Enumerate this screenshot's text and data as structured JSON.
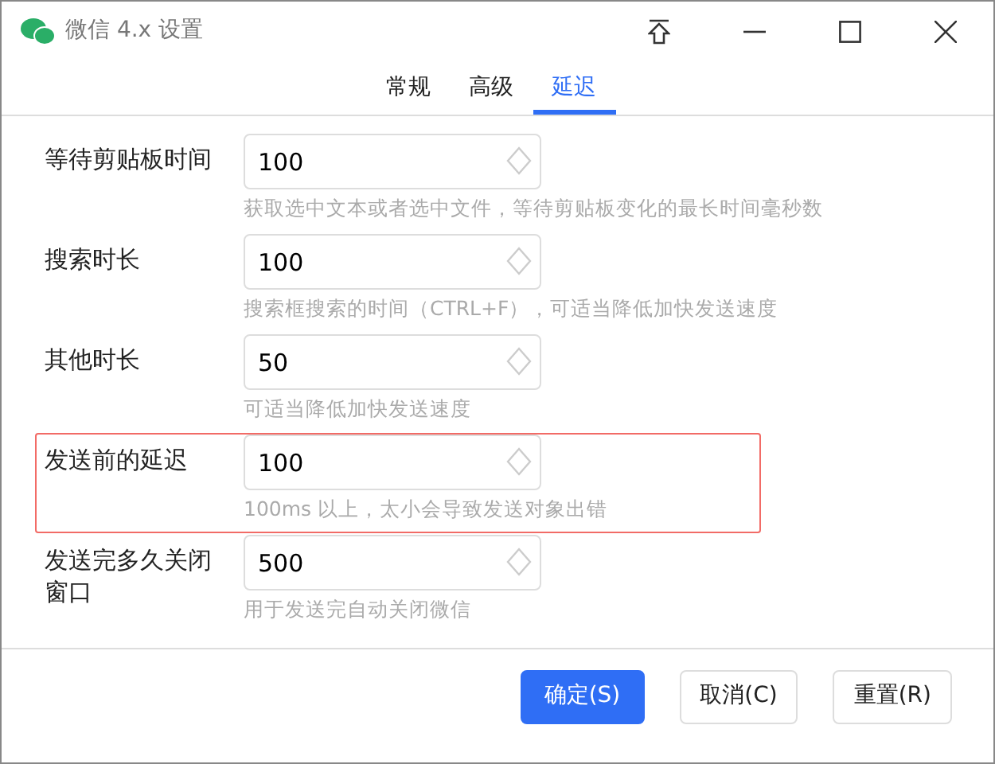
{
  "window": {
    "title": "微信 4.x 设置"
  },
  "tabs": [
    {
      "label": "常规",
      "selected": false
    },
    {
      "label": "高级",
      "selected": false
    },
    {
      "label": "延迟",
      "selected": true
    }
  ],
  "fields": [
    {
      "label": "等待剪贴板时间",
      "value": "100",
      "hint": "获取选中文本或者选中文件，等待剪贴板变化的最长时间毫秒数",
      "highlighted": false
    },
    {
      "label": "搜索时长",
      "value": "100",
      "hint": "搜索框搜索的时间（CTRL+F），可适当降低加快发送速度",
      "highlighted": false
    },
    {
      "label": "其他时长",
      "value": "50",
      "hint": "可适当降低加快发送速度",
      "highlighted": false
    },
    {
      "label": "发送前的延迟",
      "value": "100",
      "hint": "100ms 以上，太小会导致发送对象出错",
      "highlighted": true
    },
    {
      "label": "发送完多久关闭窗口",
      "value": "500",
      "hint": "用于发送完自动关闭微信",
      "highlighted": false
    }
  ],
  "buttons": [
    {
      "label": "确定(S)",
      "kind": "primary"
    },
    {
      "label": "取消(C)",
      "kind": "default"
    },
    {
      "label": "重置(R)",
      "kind": "default"
    }
  ]
}
